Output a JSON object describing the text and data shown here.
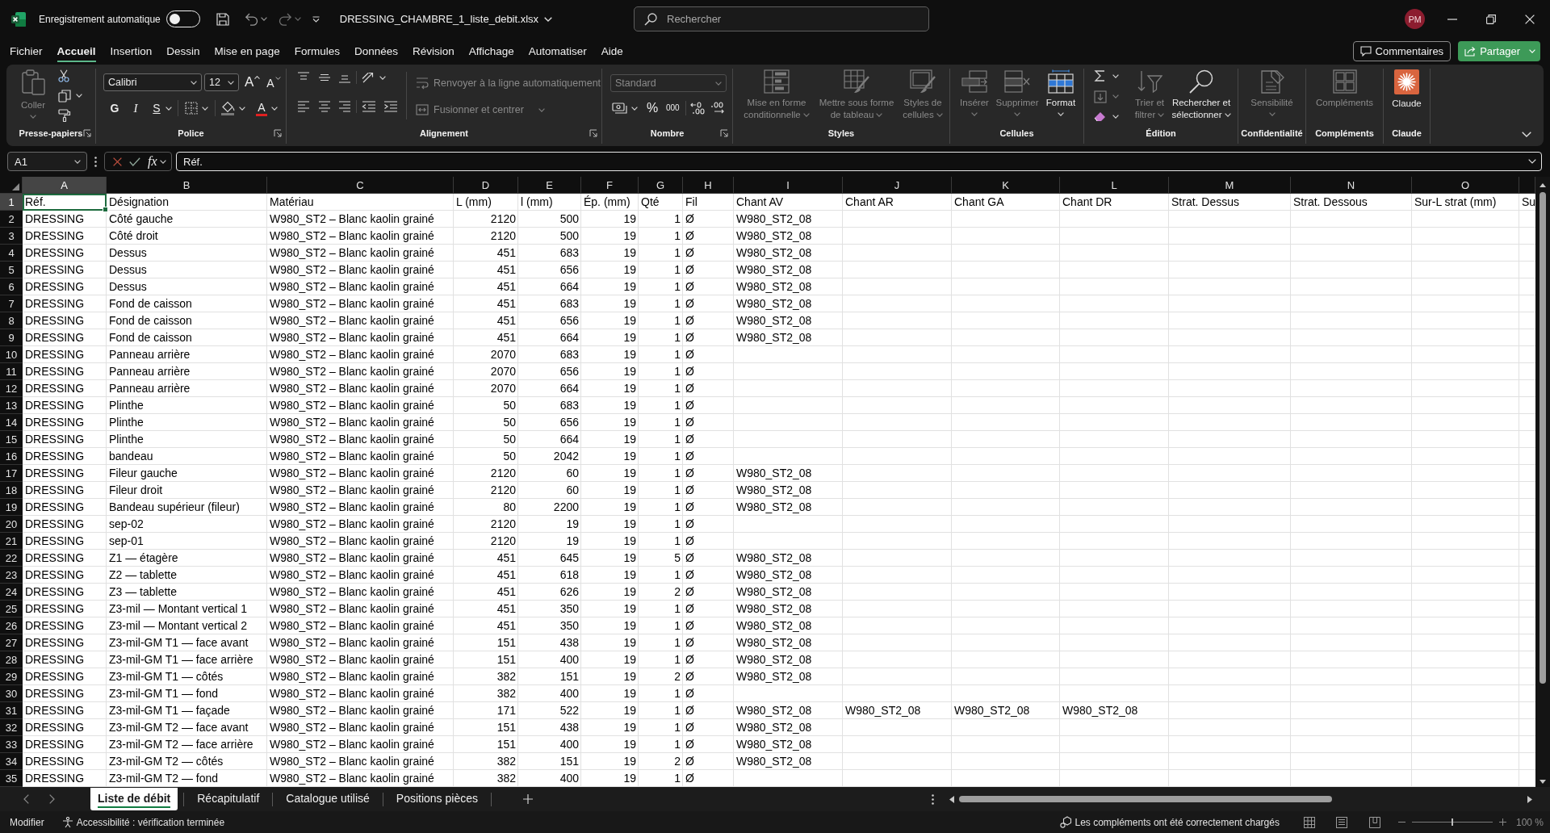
{
  "title_bar": {
    "autosave_label": "Enregistrement automatique",
    "autosave_on": false,
    "file_name": "DRESSING_CHAMBRE_1_liste_debit.xlsx",
    "search": {
      "placeholder": "Rechercher"
    },
    "user_initials": "PM"
  },
  "menu": {
    "tabs": [
      {
        "label": "Fichier",
        "selected": false
      },
      {
        "label": "Accueil",
        "selected": true
      },
      {
        "label": "Insertion",
        "selected": false
      },
      {
        "label": "Dessin",
        "selected": false
      },
      {
        "label": "Mise en page",
        "selected": false
      },
      {
        "label": "Formules",
        "selected": false
      },
      {
        "label": "Données",
        "selected": false
      },
      {
        "label": "Révision",
        "selected": false
      },
      {
        "label": "Affichage",
        "selected": false
      },
      {
        "label": "Automatiser",
        "selected": false
      },
      {
        "label": "Aide",
        "selected": false
      }
    ],
    "comments_label": "Commentaires",
    "share_label": "Partager"
  },
  "ribbon": {
    "groups": [
      {
        "kind": "clipboard",
        "label": "Presse-papiers",
        "launcher": true,
        "paste": {
          "label": "Coller",
          "disabled": true
        }
      },
      {
        "kind": "font",
        "label": "Police",
        "launcher": true,
        "font_name": "Calibri",
        "font_size": "12",
        "grow_label": "A",
        "shrink_label": "A",
        "bold_label": "G",
        "italic_label": "I",
        "underline_label": "S",
        "font_color_label": "A"
      },
      {
        "kind": "alignment",
        "label": "Alignement",
        "launcher": true,
        "wrap": {
          "label": "Renvoyer à la ligne automatiquement",
          "disabled": true
        },
        "merge": {
          "label": "Fusionner et centrer",
          "disabled": true
        }
      },
      {
        "kind": "number",
        "label": "Nombre",
        "launcher": true,
        "format": {
          "value": "Standard",
          "disabled": true
        },
        "percent_label": "%",
        "thousands_label": "000"
      },
      {
        "kind": "buttons",
        "label": "Styles",
        "launcher": false,
        "buttons": [
          {
            "kind": "conditional",
            "label": "Mise en forme conditionnelle",
            "disabled": true
          },
          {
            "kind": "table",
            "label": "Mettre sous forme de tableau",
            "disabled": true
          },
          {
            "kind": "cellstyles",
            "label": "Styles de cellules",
            "disabled": true
          }
        ]
      },
      {
        "kind": "buttons",
        "label": "Cellules",
        "launcher": false,
        "buttons": [
          {
            "kind": "insert",
            "label": "Insérer",
            "disabled": true
          },
          {
            "kind": "delete",
            "label": "Supprimer",
            "disabled": true
          },
          {
            "kind": "format",
            "label": "Format",
            "disabled": false
          }
        ]
      },
      {
        "kind": "editing",
        "label": "Édition",
        "launcher": false,
        "buttons": [
          {
            "kind": "sort",
            "label": "Trier et filtrer",
            "disabled": true
          },
          {
            "kind": "find",
            "label": "Rechercher et sélectionner",
            "disabled": false
          }
        ]
      },
      {
        "kind": "buttons",
        "label": "Confidentialité",
        "launcher": false,
        "buttons": [
          {
            "kind": "sensitivity",
            "label": "Sensibilité",
            "disabled": true
          }
        ]
      },
      {
        "kind": "buttons",
        "label": "Compléments",
        "launcher": false,
        "buttons": [
          {
            "kind": "addins",
            "label": "Compléments",
            "disabled": true
          }
        ]
      },
      {
        "kind": "buttons",
        "label": "Claude",
        "launcher": false,
        "buttons": [
          {
            "kind": "claude",
            "label": "Claude",
            "disabled": false
          }
        ]
      }
    ]
  },
  "formula_bar": {
    "name_box": "A1",
    "function_label": "fx",
    "formula": "Réf."
  },
  "sheet": {
    "columns": [
      {
        "letter": "A",
        "selected": true
      },
      {
        "letter": "B",
        "selected": false
      },
      {
        "letter": "C",
        "selected": false
      },
      {
        "letter": "D",
        "selected": false
      },
      {
        "letter": "E",
        "selected": false
      },
      {
        "letter": "F",
        "selected": false
      },
      {
        "letter": "G",
        "selected": false
      },
      {
        "letter": "H",
        "selected": false
      },
      {
        "letter": "I",
        "selected": false
      },
      {
        "letter": "J",
        "selected": false
      },
      {
        "letter": "K",
        "selected": false
      },
      {
        "letter": "L",
        "selected": false
      },
      {
        "letter": "M",
        "selected": false
      },
      {
        "letter": "N",
        "selected": false
      },
      {
        "letter": "O",
        "selected": false
      }
    ],
    "rows": [
      {
        "number": "1",
        "selected": true,
        "cells": [
          "Réf.",
          "Désignation",
          "Matériau",
          "L (mm)",
          "l (mm)",
          "Ép. (mm)",
          "Qté",
          "Fil",
          "Chant AV",
          "Chant AR",
          "Chant GA",
          "Chant DR",
          "Strat. Dessus",
          "Strat. Dessous",
          "Sur-L strat (mm)",
          "Su"
        ]
      },
      {
        "number": "2",
        "selected": false,
        "cells": [
          "DRESSING",
          "Côté gauche",
          "W980_ST2 – Blanc kaolin grainé",
          "2120",
          "500",
          "19",
          "1",
          "Ø",
          "W980_ST2_08"
        ]
      },
      {
        "number": "3",
        "selected": false,
        "cells": [
          "DRESSING",
          "Côté droit",
          "W980_ST2 – Blanc kaolin grainé",
          "2120",
          "500",
          "19",
          "1",
          "Ø",
          "W980_ST2_08"
        ]
      },
      {
        "number": "4",
        "selected": false,
        "cells": [
          "DRESSING",
          "Dessus",
          "W980_ST2 – Blanc kaolin grainé",
          "451",
          "683",
          "19",
          "1",
          "Ø",
          "W980_ST2_08"
        ]
      },
      {
        "number": "5",
        "selected": false,
        "cells": [
          "DRESSING",
          "Dessus",
          "W980_ST2 – Blanc kaolin grainé",
          "451",
          "656",
          "19",
          "1",
          "Ø",
          "W980_ST2_08"
        ]
      },
      {
        "number": "6",
        "selected": false,
        "cells": [
          "DRESSING",
          "Dessus",
          "W980_ST2 – Blanc kaolin grainé",
          "451",
          "664",
          "19",
          "1",
          "Ø",
          "W980_ST2_08"
        ]
      },
      {
        "number": "7",
        "selected": false,
        "cells": [
          "DRESSING",
          "Fond de caisson",
          "W980_ST2 – Blanc kaolin grainé",
          "451",
          "683",
          "19",
          "1",
          "Ø",
          "W980_ST2_08"
        ]
      },
      {
        "number": "8",
        "selected": false,
        "cells": [
          "DRESSING",
          "Fond de caisson",
          "W980_ST2 – Blanc kaolin grainé",
          "451",
          "656",
          "19",
          "1",
          "Ø",
          "W980_ST2_08"
        ]
      },
      {
        "number": "9",
        "selected": false,
        "cells": [
          "DRESSING",
          "Fond de caisson",
          "W980_ST2 – Blanc kaolin grainé",
          "451",
          "664",
          "19",
          "1",
          "Ø",
          "W980_ST2_08"
        ]
      },
      {
        "number": "10",
        "selected": false,
        "cells": [
          "DRESSING",
          "Panneau arrière",
          "W980_ST2 – Blanc kaolin grainé",
          "2070",
          "683",
          "19",
          "1",
          "Ø"
        ]
      },
      {
        "number": "11",
        "selected": false,
        "cells": [
          "DRESSING",
          "Panneau arrière",
          "W980_ST2 – Blanc kaolin grainé",
          "2070",
          "656",
          "19",
          "1",
          "Ø"
        ]
      },
      {
        "number": "12",
        "selected": false,
        "cells": [
          "DRESSING",
          "Panneau arrière",
          "W980_ST2 – Blanc kaolin grainé",
          "2070",
          "664",
          "19",
          "1",
          "Ø"
        ]
      },
      {
        "number": "13",
        "selected": false,
        "cells": [
          "DRESSING",
          "Plinthe",
          "W980_ST2 – Blanc kaolin grainé",
          "50",
          "683",
          "19",
          "1",
          "Ø"
        ]
      },
      {
        "number": "14",
        "selected": false,
        "cells": [
          "DRESSING",
          "Plinthe",
          "W980_ST2 – Blanc kaolin grainé",
          "50",
          "656",
          "19",
          "1",
          "Ø"
        ]
      },
      {
        "number": "15",
        "selected": false,
        "cells": [
          "DRESSING",
          "Plinthe",
          "W980_ST2 – Blanc kaolin grainé",
          "50",
          "664",
          "19",
          "1",
          "Ø"
        ]
      },
      {
        "number": "16",
        "selected": false,
        "cells": [
          "DRESSING",
          "bandeau",
          "W980_ST2 – Blanc kaolin grainé",
          "50",
          "2042",
          "19",
          "1",
          "Ø"
        ]
      },
      {
        "number": "17",
        "selected": false,
        "cells": [
          "DRESSING",
          "Fileur gauche",
          "W980_ST2 – Blanc kaolin grainé",
          "2120",
          "60",
          "19",
          "1",
          "Ø",
          "W980_ST2_08"
        ]
      },
      {
        "number": "18",
        "selected": false,
        "cells": [
          "DRESSING",
          "Fileur droit",
          "W980_ST2 – Blanc kaolin grainé",
          "2120",
          "60",
          "19",
          "1",
          "Ø",
          "W980_ST2_08"
        ]
      },
      {
        "number": "19",
        "selected": false,
        "cells": [
          "DRESSING",
          "Bandeau supérieur (fileur)",
          "W980_ST2 – Blanc kaolin grainé",
          "80",
          "2200",
          "19",
          "1",
          "Ø",
          "W980_ST2_08"
        ]
      },
      {
        "number": "20",
        "selected": false,
        "cells": [
          "DRESSING",
          "sep-02",
          "W980_ST2 – Blanc kaolin grainé",
          "2120",
          "19",
          "19",
          "1",
          "Ø"
        ]
      },
      {
        "number": "21",
        "selected": false,
        "cells": [
          "DRESSING",
          "sep-01",
          "W980_ST2 – Blanc kaolin grainé",
          "2120",
          "19",
          "19",
          "1",
          "Ø"
        ]
      },
      {
        "number": "22",
        "selected": false,
        "cells": [
          "DRESSING",
          "Z1 — étagère",
          "W980_ST2 – Blanc kaolin grainé",
          "451",
          "645",
          "19",
          "5",
          "Ø",
          "W980_ST2_08"
        ]
      },
      {
        "number": "23",
        "selected": false,
        "cells": [
          "DRESSING",
          "Z2 — tablette",
          "W980_ST2 – Blanc kaolin grainé",
          "451",
          "618",
          "19",
          "1",
          "Ø",
          "W980_ST2_08"
        ]
      },
      {
        "number": "24",
        "selected": false,
        "cells": [
          "DRESSING",
          "Z3 — tablette",
          "W980_ST2 – Blanc kaolin grainé",
          "451",
          "626",
          "19",
          "2",
          "Ø",
          "W980_ST2_08"
        ]
      },
      {
        "number": "25",
        "selected": false,
        "cells": [
          "DRESSING",
          "Z3-mil — Montant vertical 1",
          "W980_ST2 – Blanc kaolin grainé",
          "451",
          "350",
          "19",
          "1",
          "Ø",
          "W980_ST2_08"
        ]
      },
      {
        "number": "26",
        "selected": false,
        "cells": [
          "DRESSING",
          "Z3-mil — Montant vertical 2",
          "W980_ST2 – Blanc kaolin grainé",
          "451",
          "350",
          "19",
          "1",
          "Ø",
          "W980_ST2_08"
        ]
      },
      {
        "number": "27",
        "selected": false,
        "cells": [
          "DRESSING",
          "Z3-mil-GM T1 — face avant",
          "W980_ST2 – Blanc kaolin grainé",
          "151",
          "438",
          "19",
          "1",
          "Ø",
          "W980_ST2_08"
        ]
      },
      {
        "number": "28",
        "selected": false,
        "cells": [
          "DRESSING",
          "Z3-mil-GM T1 — face arrière",
          "W980_ST2 – Blanc kaolin grainé",
          "151",
          "400",
          "19",
          "1",
          "Ø",
          "W980_ST2_08"
        ]
      },
      {
        "number": "29",
        "selected": false,
        "cells": [
          "DRESSING",
          "Z3-mil-GM T1 — côtés",
          "W980_ST2 – Blanc kaolin grainé",
          "382",
          "151",
          "19",
          "2",
          "Ø",
          "W980_ST2_08"
        ]
      },
      {
        "number": "30",
        "selected": false,
        "cells": [
          "DRESSING",
          "Z3-mil-GM T1 — fond",
          "W980_ST2 – Blanc kaolin grainé",
          "382",
          "400",
          "19",
          "1",
          "Ø"
        ]
      },
      {
        "number": "31",
        "selected": false,
        "cells": [
          "DRESSING",
          "Z3-mil-GM T1 — façade",
          "W980_ST2 – Blanc kaolin grainé",
          "171",
          "522",
          "19",
          "1",
          "Ø",
          "W980_ST2_08",
          "W980_ST2_08",
          "W980_ST2_08",
          "W980_ST2_08"
        ]
      },
      {
        "number": "32",
        "selected": false,
        "cells": [
          "DRESSING",
          "Z3-mil-GM T2 — face avant",
          "W980_ST2 – Blanc kaolin grainé",
          "151",
          "438",
          "19",
          "1",
          "Ø",
          "W980_ST2_08"
        ]
      },
      {
        "number": "33",
        "selected": false,
        "cells": [
          "DRESSING",
          "Z3-mil-GM T2 — face arrière",
          "W980_ST2 – Blanc kaolin grainé",
          "151",
          "400",
          "19",
          "1",
          "Ø",
          "W980_ST2_08"
        ]
      },
      {
        "number": "34",
        "selected": false,
        "cells": [
          "DRESSING",
          "Z3-mil-GM T2 — côtés",
          "W980_ST2 – Blanc kaolin grainé",
          "382",
          "151",
          "19",
          "2",
          "Ø",
          "W980_ST2_08"
        ]
      },
      {
        "number": "35",
        "selected": false,
        "cells": [
          "DRESSING",
          "Z3-mil-GM T2 — fond",
          "W980_ST2 – Blanc kaolin grainé",
          "382",
          "400",
          "19",
          "1",
          "Ø"
        ]
      }
    ]
  },
  "sheet_tabs": {
    "tabs": [
      {
        "label": "Liste de débit",
        "selected": true
      },
      {
        "label": "Récapitulatif",
        "selected": false
      },
      {
        "label": "Catalogue utilisé",
        "selected": false
      },
      {
        "label": "Positions pièces",
        "selected": false
      }
    ]
  },
  "status_bar": {
    "mode": "Modifier",
    "accessibility": "Accessibilité : vérification terminée",
    "addins_message": "Les compléments ont été correctement chargés",
    "zoom": {
      "level": 0.5,
      "label": "100 %"
    }
  }
}
